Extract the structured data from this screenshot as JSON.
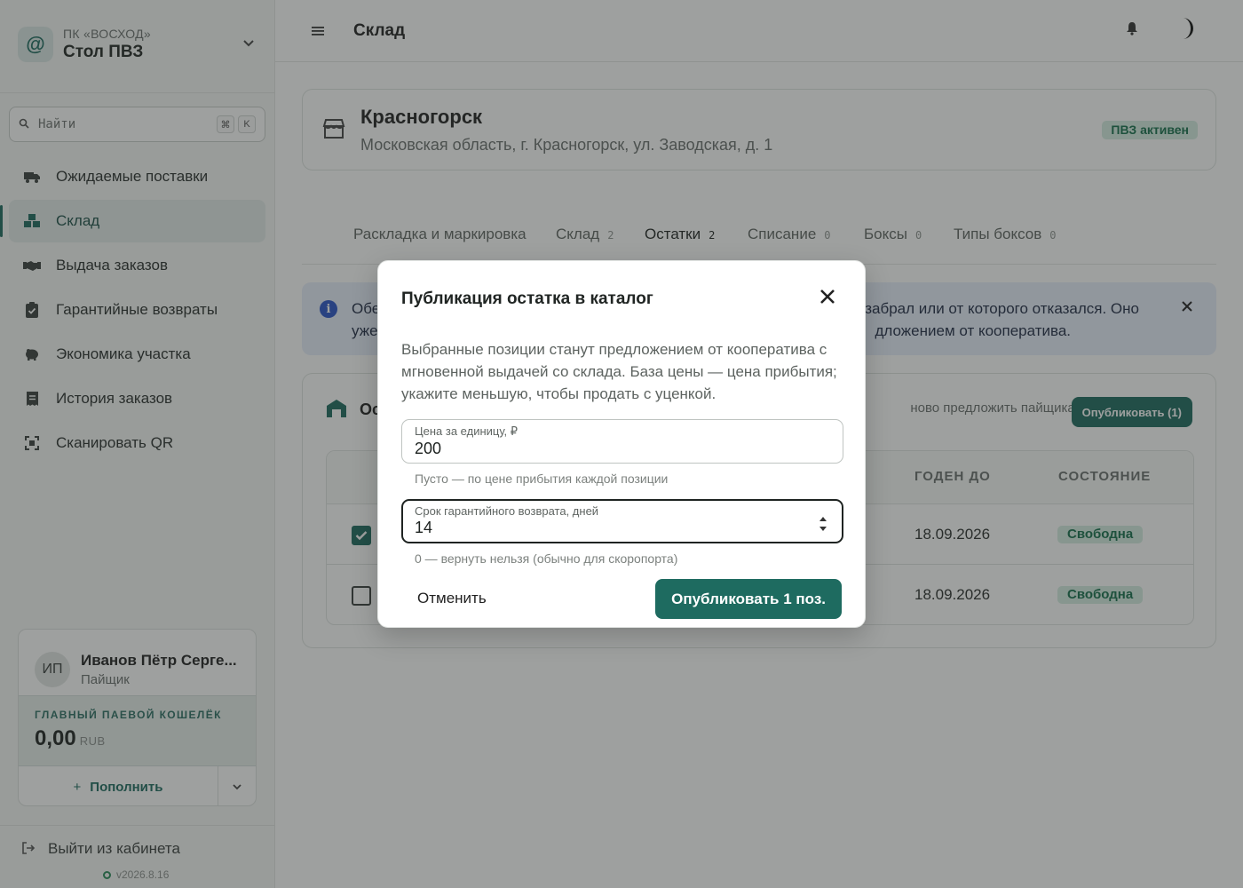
{
  "sidebar": {
    "org_subtitle": "ПК «ВОСХОД»",
    "org_name": "Стол ПВЗ",
    "search_placeholder": "Найти",
    "shortcut_key1": "⌘",
    "shortcut_key2": "K",
    "items": [
      {
        "label": "Ожидаемые поставки",
        "icon": "truck-icon"
      },
      {
        "label": "Склад",
        "icon": "boxes-icon"
      },
      {
        "label": "Выдача заказов",
        "icon": "handshake-icon"
      },
      {
        "label": "Гарантийные возвраты",
        "icon": "clipboard-check-icon"
      },
      {
        "label": "Экономика участка",
        "icon": "piggy-bank-icon"
      },
      {
        "label": "История заказов",
        "icon": "receipt-icon"
      },
      {
        "label": "Сканировать QR",
        "icon": "qr-scan-icon"
      }
    ],
    "active_index": 1,
    "user": {
      "initials": "ИП",
      "name": "Иванов Пётр Серге...",
      "role": "Пайщик"
    },
    "wallet": {
      "label": "ГЛАВНЫЙ ПАЕВОЙ КОШЕЛЁК",
      "amount": "0,00",
      "currency": "RUB",
      "topup_label": "Пополнить"
    },
    "logout_label": "Выйти из кабинета",
    "version": "v2026.8.16"
  },
  "header": {
    "title": "Склад"
  },
  "location": {
    "name": "Красногорск",
    "address": "Московская область, г. Красногорск, ул. Заводская, д. 1",
    "status": "ПВЗ активен"
  },
  "tabs": [
    {
      "label": "Раскладка и маркировка",
      "count": ""
    },
    {
      "label": "Склад",
      "count": "2"
    },
    {
      "label": "Остатки",
      "count": "2"
    },
    {
      "label": "Списание",
      "count": "0"
    },
    {
      "label": "Боксы",
      "count": "0"
    },
    {
      "label": "Типы боксов",
      "count": "0"
    }
  ],
  "active_tab": 2,
  "alert": {
    "text": "Обе… забрал или от которого отказался. Оно уже… дложением от кооператива.",
    "line1_left": "Обе",
    "line1_right": "забрал или от которого отказался. Оно",
    "line2_left": "уже",
    "line2_right": "дложением от кооператива."
  },
  "stock": {
    "title": "Ос",
    "hint": "ново предложить пайщикам",
    "publish_button": "Опубликовать (1)",
    "columns": [
      "ГОДЕН ДО",
      "СОСТОЯНИЕ"
    ],
    "rows": [
      {
        "checked": true,
        "expires": "18.09.2026",
        "state": "Свободна"
      },
      {
        "checked": false,
        "expires": "18.09.2026",
        "state": "Свободна"
      }
    ]
  },
  "modal": {
    "title": "Публикация остатка в каталог",
    "description": "Выбранные позиции станут предложением от кооператива с мгновенной выдачей со склада. База цены — цена прибытия; укажите меньшую, чтобы продать с уценкой.",
    "price_label": "Цена за единицу, ₽",
    "price_value": "200",
    "price_help": "Пусто — по цене прибытия каждой позиции",
    "warranty_label": "Срок гарантийного возврата, дней",
    "warranty_value": "14",
    "warranty_help": "0 — вернуть нельзя (обычно для скоропорта)",
    "cancel_label": "Отменить",
    "publish_label": "Опубликовать 1 поз."
  },
  "colors": {
    "accent": "#1e6b60",
    "status_green": "#17704d",
    "info_blue": "#2a55c9"
  }
}
